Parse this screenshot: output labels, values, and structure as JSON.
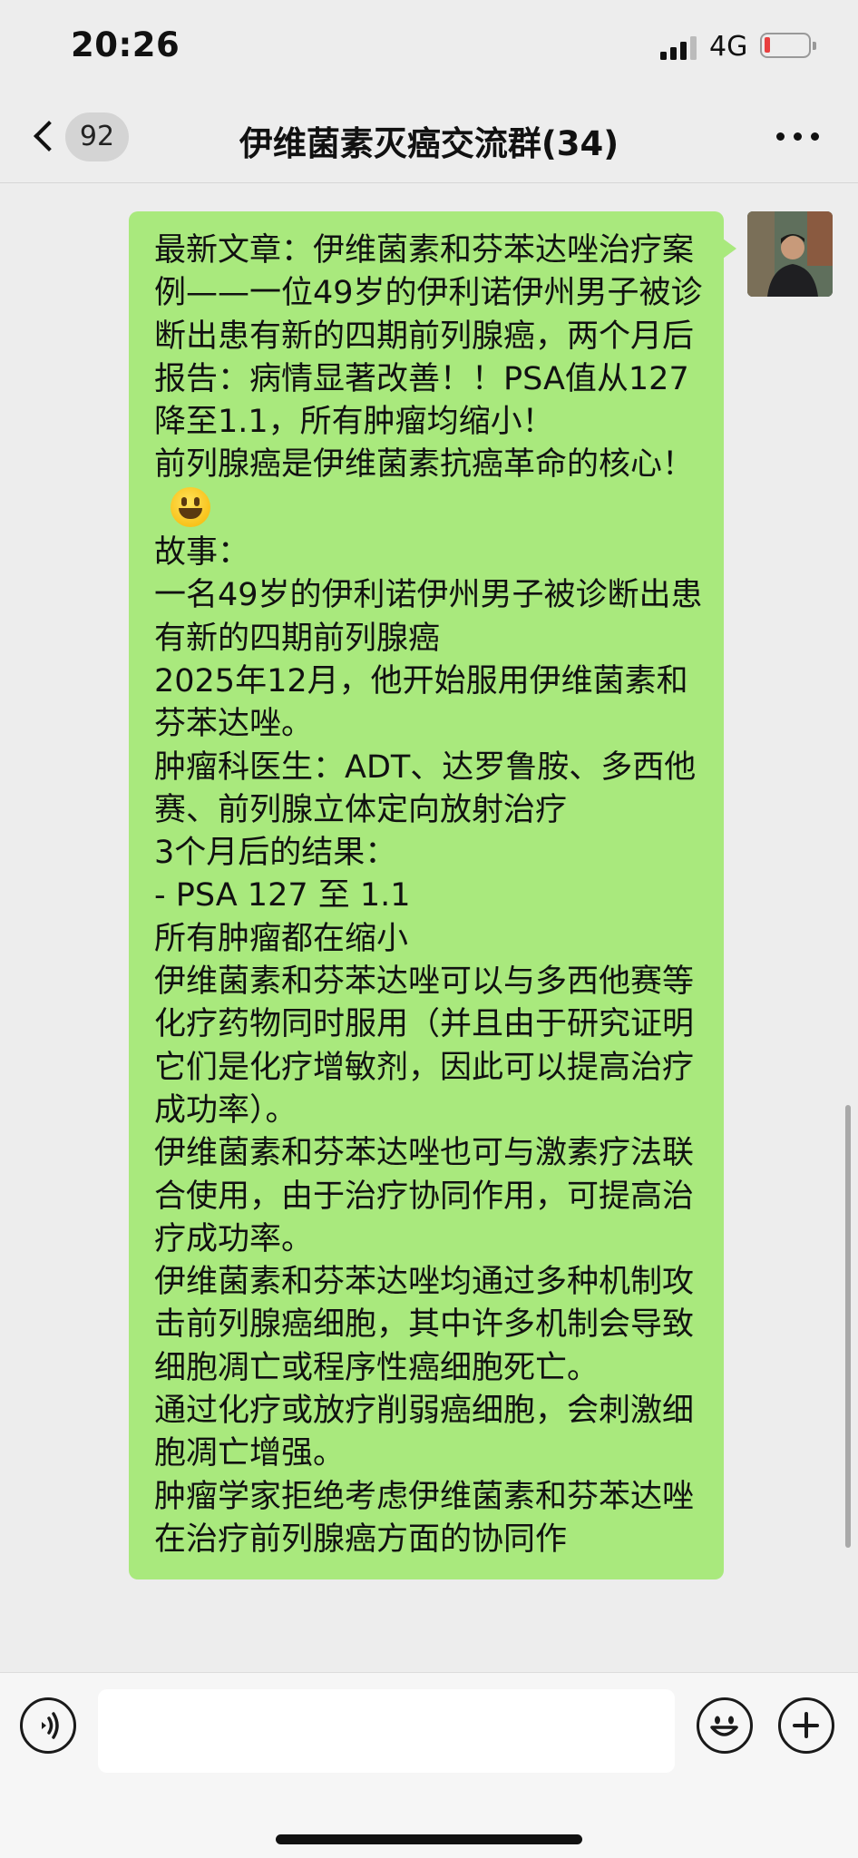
{
  "status_bar": {
    "time": "20:26",
    "network": "4G",
    "battery_color": "#e84040"
  },
  "header": {
    "back_icon": "chevron-left-icon",
    "unread_count": "92",
    "title": "伊维菌素灭癌交流群(34)",
    "more_icon": "more-dots-icon"
  },
  "message": {
    "sender": "self",
    "bubble_color": "#a9e97d",
    "lines": [
      "最新文章：伊维菌素和芬苯达唑治疗案例——一位49岁的伊利诺伊州男子被诊断出患有新的四期前列腺癌，两个月后报告：病情显著改善！！PSA值从127降至1.1，所有肿瘤均缩小！",
      "前列腺癌是伊维菌素抗癌革命的核心！",
      "故事：",
      "一名49岁的伊利诺伊州男子被诊断出患有新的四期前列腺癌",
      "2025年12月，他开始服用伊维菌素和芬苯达唑。",
      "肿瘤科医生：ADT、达罗鲁胺、多西他赛、前列腺立体定向放射治疗",
      "3个月后的结果：",
      "- PSA 127 至 1.1",
      "所有肿瘤都在缩小",
      "伊维菌素和芬苯达唑可以与多西他赛等化疗药物同时服用（并且由于研究证明它们是化疗增敏剂，因此可以提高治疗成功率）。",
      "伊维菌素和芬苯达唑也可与激素疗法联合使用，由于治疗协同作用，可提高治疗成功率。",
      "伊维菌素和芬苯达唑均通过多种机制攻击前列腺癌细胞，其中许多机制会导致细胞凋亡或程序性癌细胞死亡。",
      "通过化疗或放疗削弱癌细胞，会刺激细胞凋亡增强。",
      "肿瘤学家拒绝考虑伊维菌素和芬苯达唑在治疗前列腺癌方面的协同作"
    ],
    "emoji_after_line": 1,
    "emoji_icon": "grinning-face-icon"
  },
  "input_bar": {
    "voice_icon": "voice-icon",
    "text_value": "",
    "emoji_icon": "emoji-icon",
    "plus_icon": "plus-icon"
  }
}
